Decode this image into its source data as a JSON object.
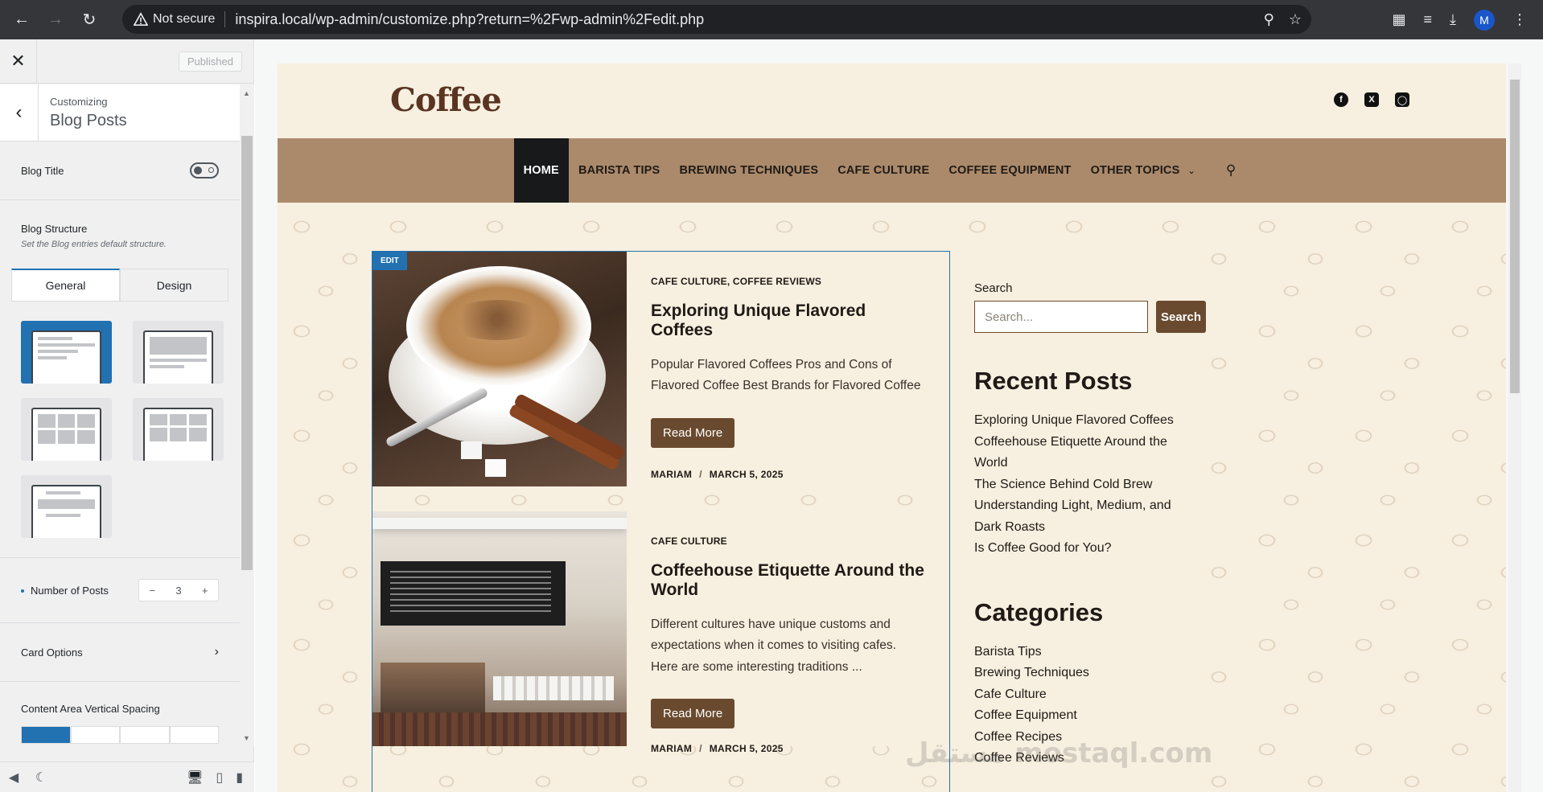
{
  "browser": {
    "security_label": "Not secure",
    "url": "inspira.local/wp-admin/customize.php?return=%2Fwp-admin%2Fedit.php",
    "profile_initial": "M"
  },
  "customizer": {
    "close_icon": "close-icon",
    "published_label": "Published",
    "section_parent": "Customizing",
    "section_title": "Blog Posts",
    "blog_title_label": "Blog Title",
    "blog_structure_label": "Blog Structure",
    "blog_structure_desc": "Set the Blog entries default structure.",
    "tabs": [
      {
        "label": "General",
        "active": true
      },
      {
        "label": "Design",
        "active": false
      }
    ],
    "number_of_posts_label": "Number of Posts",
    "number_of_posts_value": "3",
    "decrement": "−",
    "increment": "+",
    "card_options_label": "Card Options",
    "content_spacing_label": "Content Area Vertical Spacing"
  },
  "site": {
    "logo": "Coffee",
    "menu": [
      {
        "label": "HOME",
        "active": true
      },
      {
        "label": "BARISTA TIPS"
      },
      {
        "label": "BREWING TECHNIQUES"
      },
      {
        "label": "CAFE CULTURE"
      },
      {
        "label": "COFFEE EQUIPMENT"
      },
      {
        "label": "OTHER TOPICS"
      }
    ],
    "edit_label": "EDIT",
    "posts": [
      {
        "categories": "CAFE CULTURE, COFFEE REVIEWS",
        "title": "Exploring Unique Flavored Coffees",
        "excerpt": "Popular Flavored Coffees Pros and Cons of Flavored Coffee Best Brands for Flavored Coffee",
        "read_more": "Read More",
        "author": "MARIAM",
        "date": "MARCH 5, 2025"
      },
      {
        "categories": "CAFE CULTURE",
        "title": "Coffeehouse Etiquette Around the World",
        "excerpt": "Different cultures have unique customs and expectations when it comes to visiting cafes. Here are some interesting traditions ...",
        "read_more": "Read More",
        "author": "MARIAM",
        "date": "MARCH 5, 2025"
      }
    ],
    "sidebar": {
      "search_label": "Search",
      "search_placeholder": "Search...",
      "search_button": "Search",
      "recent_title": "Recent Posts",
      "recent": [
        "Exploring Unique Flavored Coffees",
        "Coffeehouse Etiquette Around the World",
        "The Science Behind Cold Brew",
        "Understanding Light, Medium, and Dark Roasts",
        "Is Coffee Good for You?"
      ],
      "categories_title": "Categories",
      "categories": [
        "Barista Tips",
        "Brewing Techniques",
        "Cafe Culture",
        "Coffee Equipment",
        "Coffee Recipes",
        "Coffee Reviews"
      ]
    },
    "watermark": "مستقل mostaql.com"
  },
  "colors": {
    "accent": "#2271b1",
    "menu_bg": "#ab8a6b",
    "button_brown": "#6a4a2e",
    "site_bg": "#f7efdf"
  }
}
